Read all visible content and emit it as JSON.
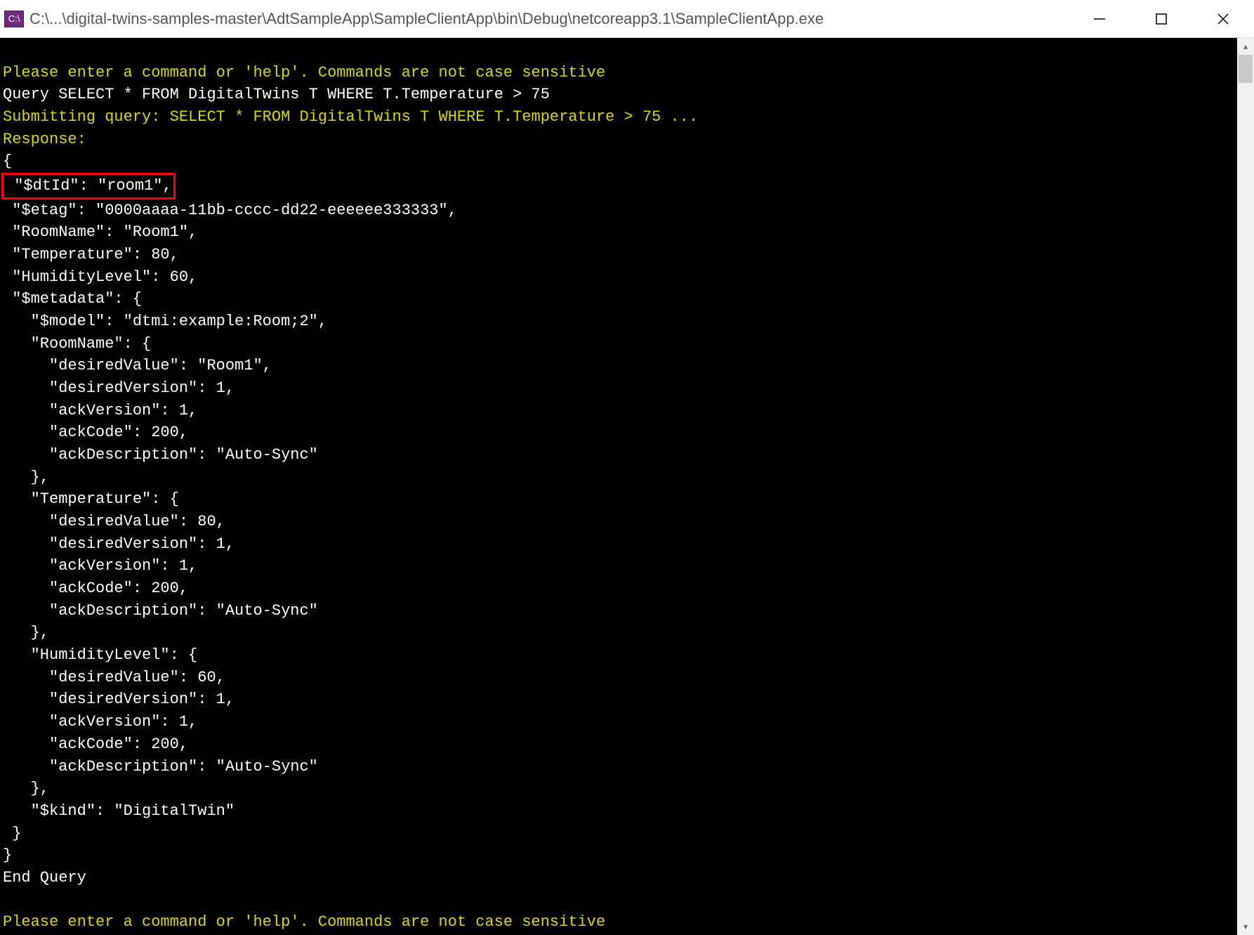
{
  "window": {
    "icon_text": "C:\\",
    "title": "C:\\...\\digital-twins-samples-master\\AdtSampleApp\\SampleClientApp\\bin\\Debug\\netcoreapp3.1\\SampleClientApp.exe"
  },
  "console": {
    "blank1": "",
    "prompt1": "Please enter a command or 'help'. Commands are not case sensitive",
    "query_line": "Query SELECT * FROM DigitalTwins T WHERE T.Temperature > 75",
    "submitting": "Submitting query: SELECT * FROM DigitalTwins T WHERE T.Temperature > 75 ...",
    "response_label": "Response:",
    "brace_open": "{",
    "highlighted": " \"$dtId\": \"room1\",",
    "lines": [
      " \"$etag\": \"0000aaaa-11bb-cccc-dd22-eeeeee333333\",",
      " \"RoomName\": \"Room1\",",
      " \"Temperature\": 80,",
      " \"HumidityLevel\": 60,",
      " \"$metadata\": {",
      "   \"$model\": \"dtmi:example:Room;2\",",
      "   \"RoomName\": {",
      "     \"desiredValue\": \"Room1\",",
      "     \"desiredVersion\": 1,",
      "     \"ackVersion\": 1,",
      "     \"ackCode\": 200,",
      "     \"ackDescription\": \"Auto-Sync\"",
      "   },",
      "   \"Temperature\": {",
      "     \"desiredValue\": 80,",
      "     \"desiredVersion\": 1,",
      "     \"ackVersion\": 1,",
      "     \"ackCode\": 200,",
      "     \"ackDescription\": \"Auto-Sync\"",
      "   },",
      "   \"HumidityLevel\": {",
      "     \"desiredValue\": 60,",
      "     \"desiredVersion\": 1,",
      "     \"ackVersion\": 1,",
      "     \"ackCode\": 200,",
      "     \"ackDescription\": \"Auto-Sync\"",
      "   },",
      "   \"$kind\": \"DigitalTwin\"",
      " }",
      "}"
    ],
    "end_query": "End Query",
    "blank2": "",
    "prompt2": "Please enter a command or 'help'. Commands are not case sensitive"
  }
}
